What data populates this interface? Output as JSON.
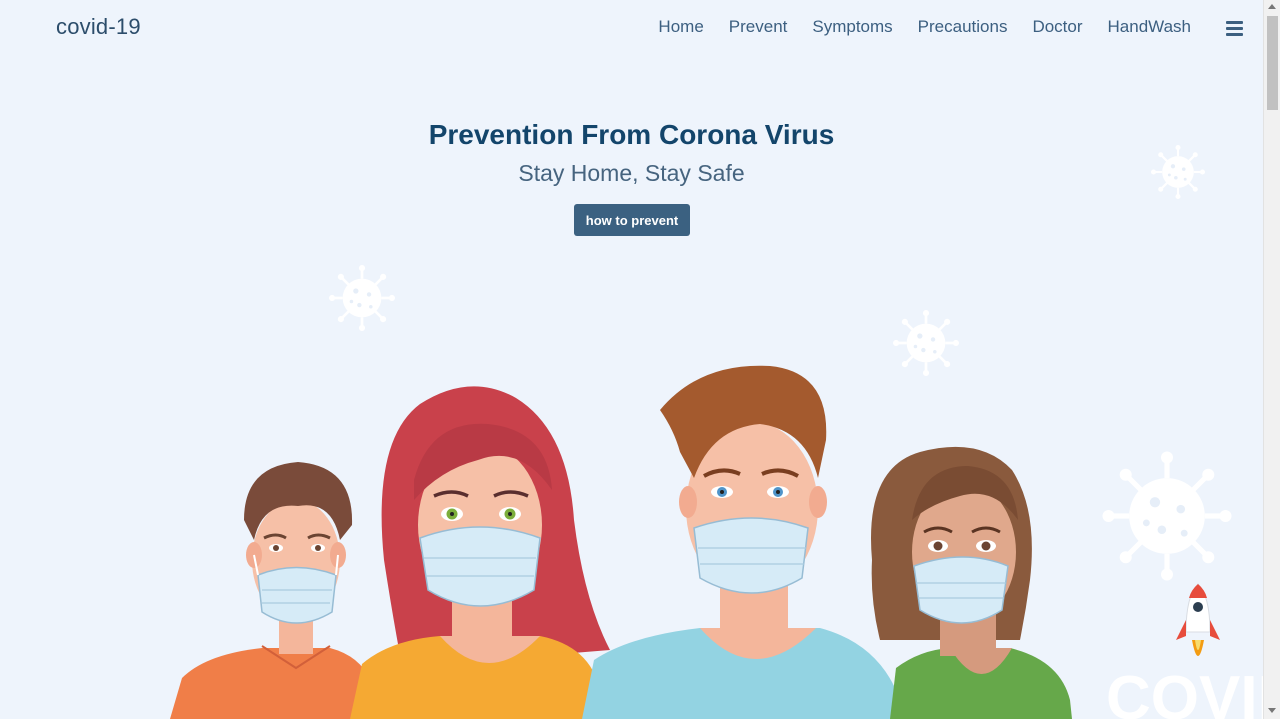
{
  "header": {
    "brand": "covid-19",
    "nav": [
      "Home",
      "Prevent",
      "Symptoms",
      "Precautions",
      "Doctor",
      "HandWash"
    ],
    "menu_icon": "hamburger-icon"
  },
  "hero": {
    "title": "Prevention From Corona Virus",
    "subtitle": "Stay Home, Stay Safe",
    "cta_label": "how to prevent"
  },
  "decor": {
    "watermark_text": "COVID",
    "virus_icon": "virus-icon",
    "rocket_icon": "rocket-icon"
  },
  "colors": {
    "background": "#eef4fc",
    "title": "#13456b",
    "button": "#3b6181"
  }
}
